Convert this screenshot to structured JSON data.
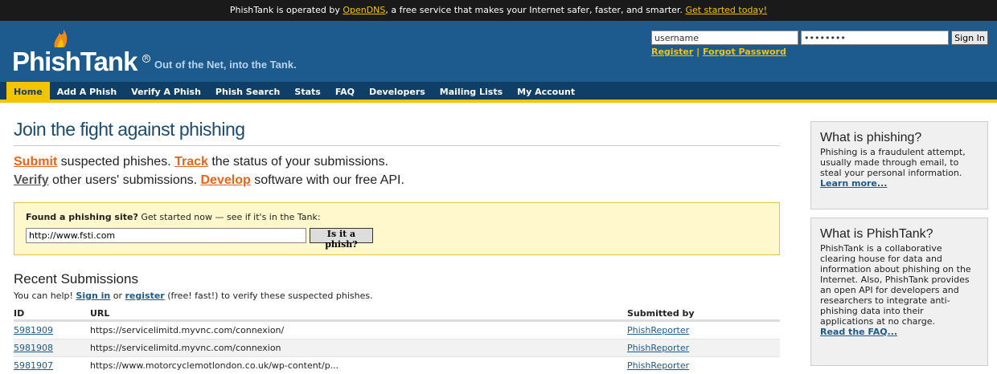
{
  "notice": {
    "text_before": "PhishTank is operated by ",
    "link1": "OpenDNS",
    "text_middle": ", a free service that makes your Internet safer, faster, and smarter. ",
    "link2": "Get started today!"
  },
  "header": {
    "logo": "PhishTank",
    "reg_mark": "R",
    "tagline": "Out of the Net, into the Tank.",
    "username_value": "username",
    "password_value": "••••••••",
    "signin_label": "Sign In",
    "register_label": "Register",
    "separator": " | ",
    "forgot_label": "Forgot Password"
  },
  "nav": {
    "items": [
      "Home",
      "Add A Phish",
      "Verify A Phish",
      "Phish Search",
      "Stats",
      "FAQ",
      "Developers",
      "Mailing Lists",
      "My Account"
    ]
  },
  "main": {
    "title": "Join the fight against phishing",
    "intro": {
      "submit": "Submit",
      "t1": " suspected phishes. ",
      "track": "Track",
      "t2": " the status of your submissions.",
      "verify": "Verify",
      "t3": " other users' submissions. ",
      "develop": "Develop",
      "t4": " software with our free API."
    },
    "find": {
      "label_bold": "Found a phishing site?",
      "label_rest": " Get started now — see if it's in the Tank:",
      "input_value": "http://www.fsti.com",
      "button": "Is it a phish?"
    },
    "recent": {
      "title": "Recent Submissions",
      "sub_before": "You can help! ",
      "signin": "Sign in",
      "sub_or": " or ",
      "register": "register",
      "sub_after": " (free! fast!) to verify these suspected phishes.",
      "headers": {
        "id": "ID",
        "url": "URL",
        "submitted": "Submitted by"
      },
      "rows": [
        {
          "id": "5981909",
          "url": "https://servicelimitd.myvnc.com/connexion/",
          "by": "PhishReporter"
        },
        {
          "id": "5981908",
          "url": "https://servicelimitd.myvnc.com/connexion",
          "by": "PhishReporter"
        },
        {
          "id": "5981907",
          "url": "https://www.motorcyclemotlondon.co.uk/wp-content/p...",
          "by": "PhishReporter"
        }
      ]
    }
  },
  "sidebar": {
    "box1": {
      "title": "What is phishing?",
      "body": "Phishing is a fraudulent attempt, usually made through email, to steal your personal information.",
      "link": "Learn more..."
    },
    "box2": {
      "title": "What is PhishTank?",
      "body": "PhishTank is a collaborative clearing house for data and information about phishing on the Internet. Also, PhishTank provides an open API for developers and researchers to integrate anti-phishing data into their applications at no charge.",
      "link": "Read the FAQ..."
    }
  }
}
